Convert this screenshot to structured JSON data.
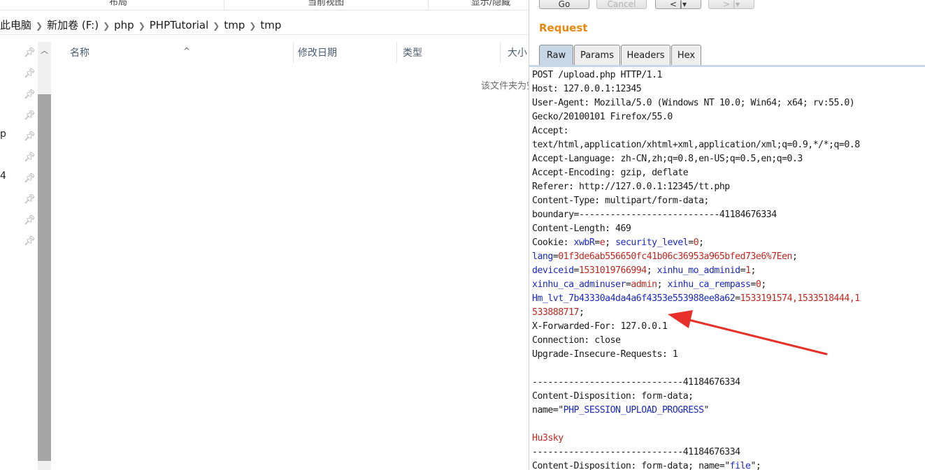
{
  "ribbon": {
    "groups": [
      "布局",
      "当前视图",
      "显示/隐藏"
    ]
  },
  "breadcrumb": [
    "此电脑",
    "新加卷 (F:)",
    "php",
    "PHPTutorial",
    "tmp",
    "tmp"
  ],
  "navpane": {
    "fragments": [
      "p",
      "4"
    ]
  },
  "columns": {
    "name": "名称",
    "modified": "修改日期",
    "type": "类型",
    "size": "大小"
  },
  "empty_message": "该文件夹为空。",
  "burp": {
    "buttons": {
      "go": "Go",
      "cancel": "Cancel",
      "back": "< |▾",
      "forward": "> |▾"
    },
    "section_title": "Request",
    "tabs": [
      "Raw",
      "Params",
      "Headers",
      "Hex"
    ],
    "active_tab": "Raw",
    "colors": {
      "accent": "#e8870f",
      "param_name": "#1a2ac0",
      "param_value": "#c0271e"
    },
    "request_lines": [
      {
        "text": "POST /upload.php HTTP/1.1"
      },
      {
        "text": "Host: 127.0.0.1:12345"
      },
      {
        "text": "User-Agent: Mozilla/5.0 (Windows NT 10.0; Win64; x64; rv:55.0)"
      },
      {
        "text": "Gecko/20100101 Firefox/55.0"
      },
      {
        "text": "Accept:"
      },
      {
        "text": "text/html,application/xhtml+xml,application/xml;q=0.9,*/*;q=0.8"
      },
      {
        "text": "Accept-Language: zh-CN,zh;q=0.8,en-US;q=0.5,en;q=0.3"
      },
      {
        "text": "Accept-Encoding: gzip, deflate"
      },
      {
        "text": "Referer: http://127.0.0.1:12345/tt.php"
      },
      {
        "text": "Content-Type: multipart/form-data;"
      },
      {
        "text": "boundary=---------------------------41184676334"
      },
      {
        "text": "Content-Length: 469"
      },
      {
        "segments": [
          {
            "t": "Cookie: "
          },
          {
            "t": "xwbR",
            "c": "k"
          },
          {
            "t": "="
          },
          {
            "t": "e",
            "c": "v"
          },
          {
            "t": "; "
          },
          {
            "t": "security_level",
            "c": "k"
          },
          {
            "t": "="
          },
          {
            "t": "0",
            "c": "v"
          },
          {
            "t": ";"
          }
        ]
      },
      {
        "segments": [
          {
            "t": "lang",
            "c": "k"
          },
          {
            "t": "="
          },
          {
            "t": "01f3de6ab556650fc41b06c36953a965bfed73e6%7Een",
            "c": "v"
          },
          {
            "t": ";"
          }
        ]
      },
      {
        "segments": [
          {
            "t": "deviceid",
            "c": "k"
          },
          {
            "t": "="
          },
          {
            "t": "1531019766994",
            "c": "v"
          },
          {
            "t": "; "
          },
          {
            "t": "xinhu_mo_adminid",
            "c": "k"
          },
          {
            "t": "="
          },
          {
            "t": "1",
            "c": "v"
          },
          {
            "t": ";"
          }
        ]
      },
      {
        "segments": [
          {
            "t": "xinhu_ca_adminuser",
            "c": "k"
          },
          {
            "t": "="
          },
          {
            "t": "admin",
            "c": "v"
          },
          {
            "t": "; "
          },
          {
            "t": "xinhu_ca_rempass",
            "c": "k"
          },
          {
            "t": "="
          },
          {
            "t": "0",
            "c": "v"
          },
          {
            "t": ";"
          }
        ]
      },
      {
        "segments": [
          {
            "t": "Hm_lvt_7b43330a4da4a6f4353e553988ee8a62",
            "c": "k"
          },
          {
            "t": "="
          },
          {
            "t": "1533191574,1533518444,1",
            "c": "v"
          }
        ]
      },
      {
        "segments": [
          {
            "t": "533888717",
            "c": "v"
          },
          {
            "t": ";"
          }
        ]
      },
      {
        "text": "X-Forwarded-For: 127.0.0.1"
      },
      {
        "text": "Connection: close"
      },
      {
        "text": "Upgrade-Insecure-Requests: 1"
      },
      {
        "text": ""
      },
      {
        "text": "-----------------------------41184676334"
      },
      {
        "text": "Content-Disposition: form-data;"
      },
      {
        "segments": [
          {
            "t": "name=\""
          },
          {
            "t": "PHP_SESSION_UPLOAD_PROGRESS",
            "c": "k"
          },
          {
            "t": "\""
          }
        ]
      },
      {
        "text": ""
      },
      {
        "segments": [
          {
            "t": "Hu3sky",
            "c": "v"
          }
        ]
      },
      {
        "text": "-----------------------------41184676334"
      },
      {
        "segments": [
          {
            "t": "Content-Disposition: form-data; name=\""
          },
          {
            "t": "file",
            "c": "k"
          },
          {
            "t": "\";"
          }
        ]
      }
    ]
  }
}
